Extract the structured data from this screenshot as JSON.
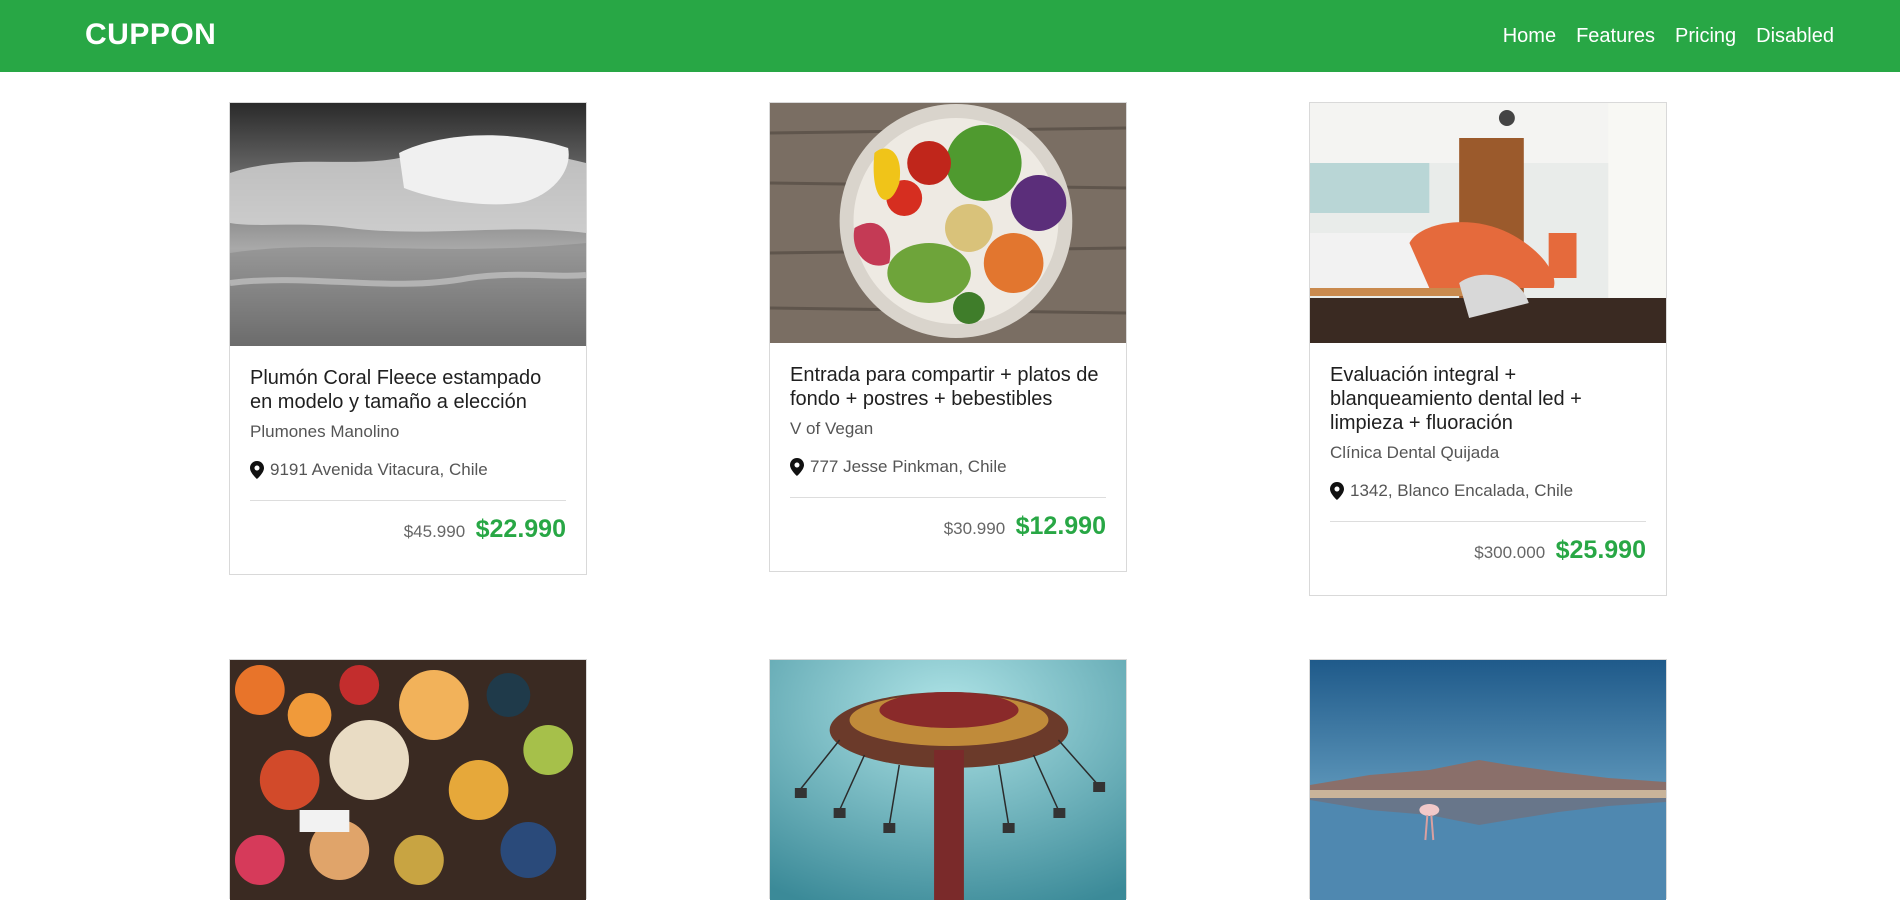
{
  "navbar": {
    "brand": "CUPPON",
    "links": [
      "Home",
      "Features",
      "Pricing",
      "Disabled"
    ],
    "color": "#28a745"
  },
  "cards": [
    {
      "image": "bed-image",
      "title": "Plumón Coral Fleece estampado en modelo y tamaño a elección",
      "merchant": "Plumones Manolino",
      "location": "9191 Avenida Vitacura, Chile",
      "old_price": "$45.990",
      "new_price": "$22.990"
    },
    {
      "image": "salad-bowl-image",
      "title": "Entrada para compartir + platos de fondo + postres + bebestibles",
      "merchant": "V of Vegan",
      "location": "777 Jesse Pinkman, Chile",
      "old_price": "$30.990",
      "new_price": "$12.990"
    },
    {
      "image": "dental-clinic-image",
      "title": "Evaluación integral + blanqueamiento dental led + limpieza + fluoración",
      "merchant": "Clínica Dental Quijada",
      "location": "1342, Blanco Encalada, Chile",
      "old_price": "$300.000",
      "new_price": "$25.990"
    },
    {
      "image": "food-spread-image"
    },
    {
      "image": "carousel-ride-image"
    },
    {
      "image": "flamingo-lake-image"
    }
  ]
}
